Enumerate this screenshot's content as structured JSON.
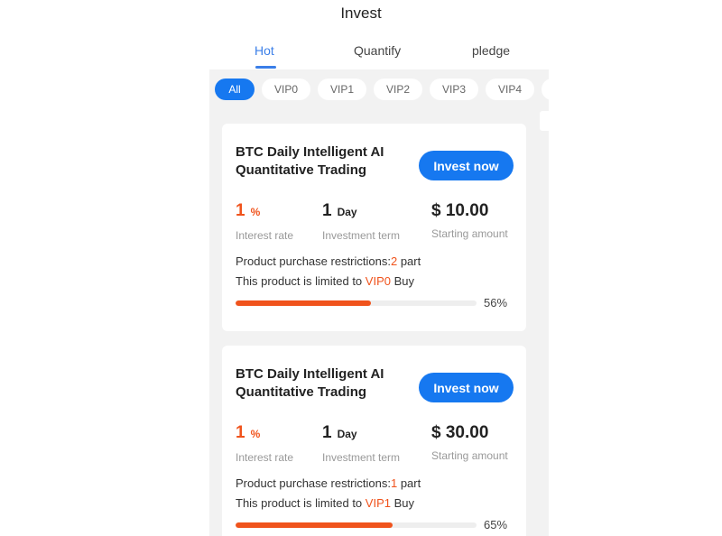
{
  "header": {
    "title": "Invest"
  },
  "tabs": [
    {
      "label": "Hot",
      "active": true
    },
    {
      "label": "Quantify",
      "active": false
    },
    {
      "label": "pledge",
      "active": false
    }
  ],
  "filters": [
    {
      "label": "All",
      "active": true
    },
    {
      "label": "VIP0",
      "active": false
    },
    {
      "label": "VIP1",
      "active": false
    },
    {
      "label": "VIP2",
      "active": false
    },
    {
      "label": "VIP3",
      "active": false
    },
    {
      "label": "VIP4",
      "active": false
    }
  ],
  "products": [
    {
      "title": "BTC Daily Intelligent AI Quantitative Trading",
      "button_label": "Invest now",
      "rate_value": "1",
      "rate_unit": "%",
      "rate_label": "Interest rate",
      "term_value": "1",
      "term_unit": "Day",
      "term_label": "Investment term",
      "amount_value": "$ 10.00",
      "amount_label": "Starting amount",
      "restriction_prefix": "Product purchase restrictions:",
      "restriction_count": "2",
      "restriction_suffix": " part",
      "limit_prefix": "This product is limited to ",
      "limit_level": "VIP0",
      "limit_suffix": " Buy",
      "progress": 56,
      "progress_text": "56%"
    },
    {
      "title": "BTC Daily Intelligent AI Quantitative Trading",
      "button_label": "Invest now",
      "rate_value": "1",
      "rate_unit": "%",
      "rate_label": "Interest rate",
      "term_value": "1",
      "term_unit": "Day",
      "term_label": "Investment term",
      "amount_value": "$ 30.00",
      "amount_label": "Starting amount",
      "restriction_prefix": "Product purchase restrictions:",
      "restriction_count": "1",
      "restriction_suffix": " part",
      "limit_prefix": "This product is limited to ",
      "limit_level": "VIP1",
      "limit_suffix": " Buy",
      "progress": 65,
      "progress_text": "65%"
    }
  ],
  "colors": {
    "primary": "#1678f0",
    "tab_active": "#3a7ee8",
    "highlight": "#f0531c",
    "panel_bg": "#f2f2f2"
  }
}
